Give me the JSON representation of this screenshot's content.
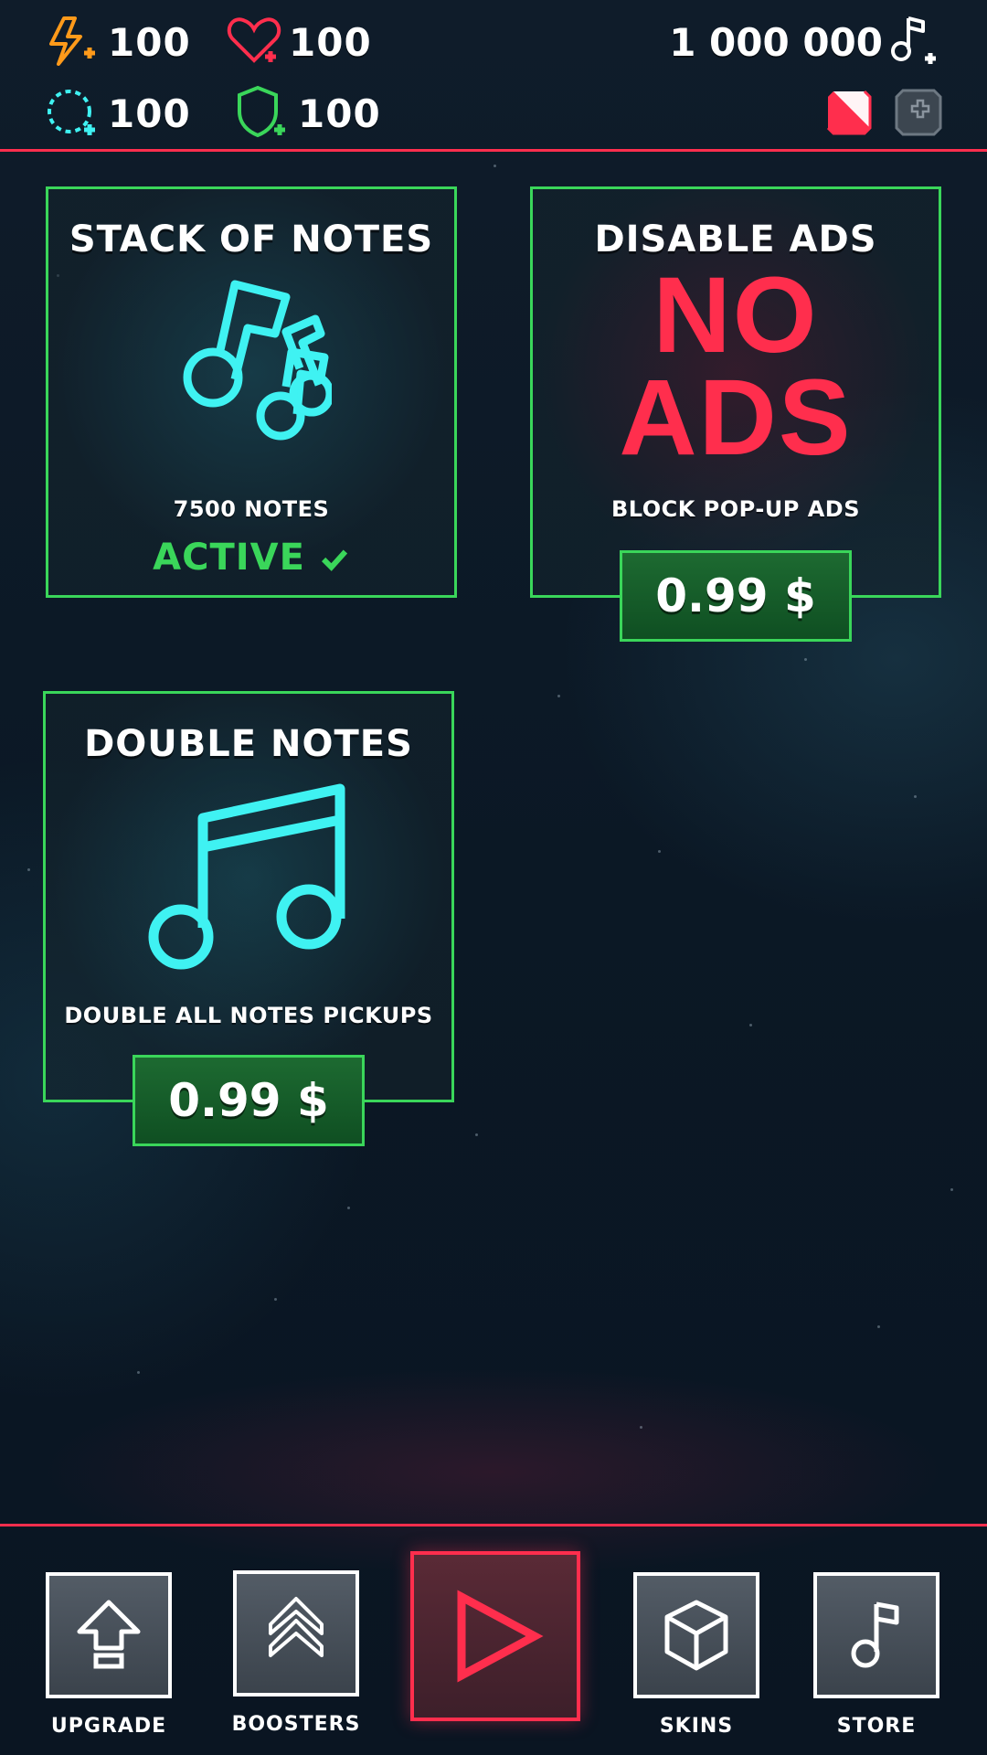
{
  "header": {
    "energy": "100",
    "lives": "100",
    "shield_ring": "100",
    "shield": "100",
    "notes_currency": "1 000 000"
  },
  "cards": [
    {
      "title": "STACK OF NOTES",
      "description": "7500 NOTES",
      "status": "ACTIVE"
    },
    {
      "title": "DISABLE ADS",
      "big_line1": "NO",
      "big_line2": "ADS",
      "description": "BLOCK POP-UP ADS",
      "price": "0.99 $"
    },
    {
      "title": "DOUBLE NOTES",
      "description": "DOUBLE ALL NOTES PICKUPS",
      "price": "0.99 $"
    }
  ],
  "nav": {
    "upgrade": "UPGRADE",
    "boosters": "BOOSTERS",
    "skins": "SKINS",
    "store": "STORE"
  },
  "colors": {
    "accent_red": "#ff2e4d",
    "accent_green": "#3ad65a",
    "note_cyan": "#3ff2f2",
    "energy_orange": "#ff9a1a"
  },
  "icons": [
    "lightning-plus-icon",
    "heart-plus-icon",
    "ring-plus-icon",
    "shield-plus-icon",
    "music-note-plus-icon",
    "flag-icon",
    "plus-icon",
    "arrow-up-icon",
    "chevrons-up-icon",
    "play-icon",
    "cube-icon",
    "music-note-icon"
  ]
}
